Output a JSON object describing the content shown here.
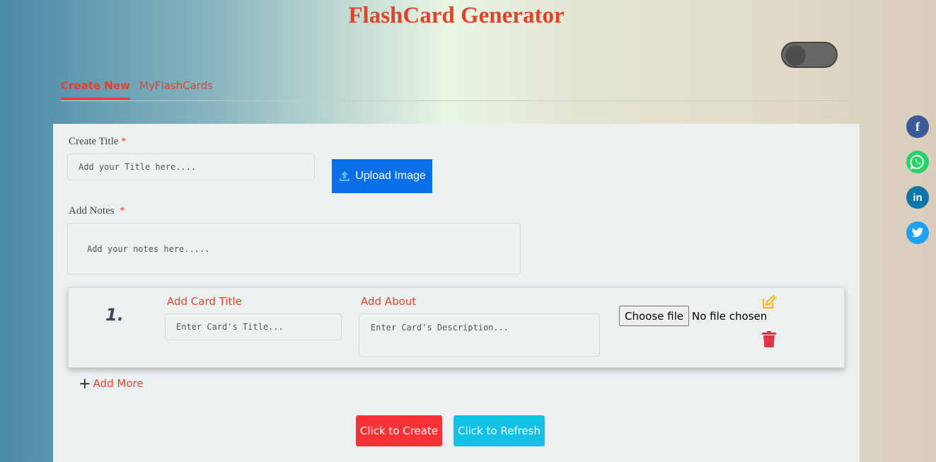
{
  "app": {
    "title": "FlashCard Generator"
  },
  "tabs": [
    {
      "label": "Create New",
      "active": true
    },
    {
      "label": "MyFlashCards",
      "active": false
    }
  ],
  "form": {
    "title_label": "Create Title",
    "title_placeholder": "Add your Title here....",
    "upload_label": "Upload Image",
    "notes_label": "Add Notes",
    "notes_placeholder": "Add your notes here.....",
    "required_mark": "*"
  },
  "card": {
    "number": "1.",
    "title_label": "Add Card Title",
    "title_placeholder": "Enter Card's Title...",
    "about_label": "Add About",
    "about_placeholder": "Enter Card's Description...",
    "file_button": "Choose file",
    "file_status": "No file chosen"
  },
  "add_more": {
    "plus": "+",
    "label": "Add More"
  },
  "actions": {
    "create": "Click to Create",
    "refresh": "Click to Refresh"
  },
  "social": [
    "facebook-icon",
    "whatsapp-icon",
    "linkedin-icon",
    "twitter-icon"
  ],
  "colors": {
    "accent": "#e0432b",
    "upload": "#0a6ee8",
    "create_button": "#fa3235",
    "refresh_button": "#13c0e6",
    "edit_icon": "#f6b91b",
    "delete_icon": "#dc3545"
  }
}
